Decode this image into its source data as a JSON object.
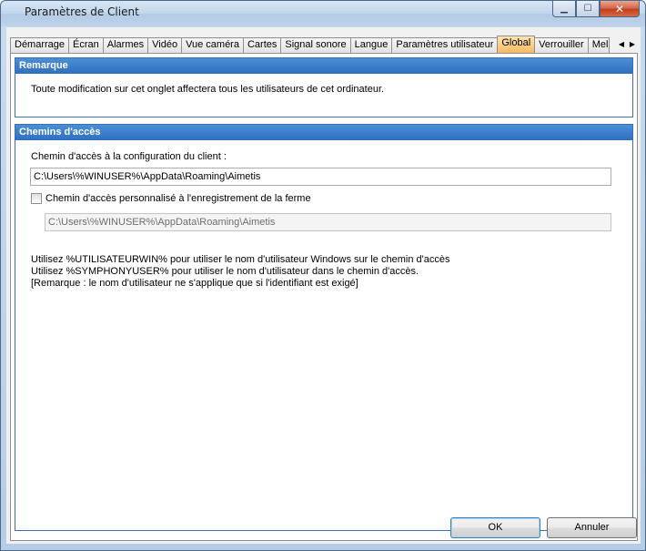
{
  "window": {
    "title": "Paramètres de  Client"
  },
  "tabs": [
    {
      "label": "Démarrage",
      "active": false
    },
    {
      "label": "Écran",
      "active": false
    },
    {
      "label": "Alarmes",
      "active": false
    },
    {
      "label": "Vidéo",
      "active": false
    },
    {
      "label": "Vue caméra",
      "active": false
    },
    {
      "label": "Cartes",
      "active": false
    },
    {
      "label": "Signal sonore",
      "active": false
    },
    {
      "label": "Langue",
      "active": false
    },
    {
      "label": "Paramètres utilisateur",
      "active": false
    },
    {
      "label": "Global",
      "active": true
    },
    {
      "label": "Verrouiller",
      "active": false
    },
    {
      "label": "Mel",
      "active": false
    }
  ],
  "remarque": {
    "header": "Remarque",
    "text": "Toute modification sur cet onglet affectera tous les utilisateurs de cet ordinateur."
  },
  "chemins": {
    "header": "Chemins d'accès",
    "config_label": "Chemin d'accès à la configuration du client :",
    "config_value": "C:\\Users\\%WINUSER%\\AppData\\Roaming\\Aimetis",
    "custom_checkbox_label": "Chemin d'accès personnalisé à l'enregistrement de la ferme",
    "custom_checked": false,
    "custom_value": "C:\\Users\\%WINUSER%\\AppData\\Roaming\\Aimetis",
    "help_lines": [
      "Utilisez %UTILISATEURWIN% pour utiliser le nom d'utilisateur Windows sur le chemin d'accès",
      "Utilisez %SYMPHONYUSER% pour utiliser le nom d'utilisateur  dans le chemin d'accès.",
      "[Remarque : le nom d'utilisateur  ne s'applique que si l'identifiant  est exigé]"
    ]
  },
  "buttons": {
    "ok": "OK",
    "cancel": "Annuler"
  },
  "colors": {
    "group_header": "#2e6fbf",
    "active_tab": "#f8b860"
  }
}
